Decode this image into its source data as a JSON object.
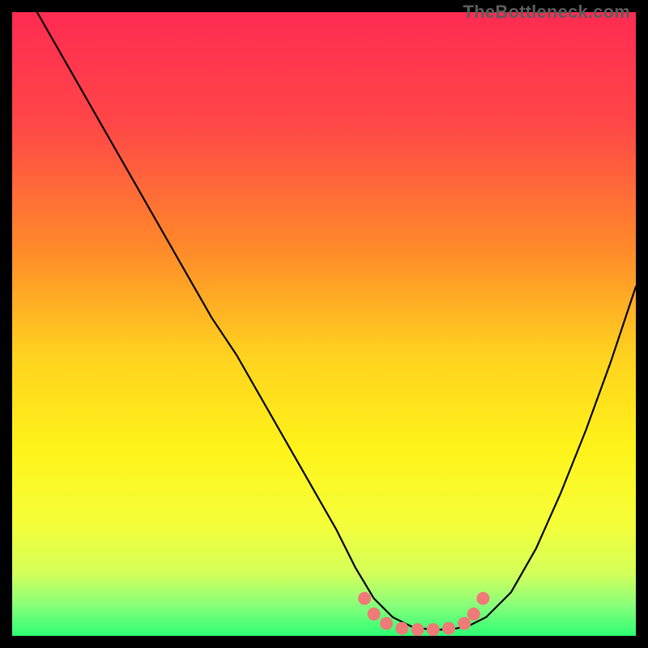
{
  "watermark": "TheBottleneck.com",
  "chart_data": {
    "type": "line",
    "title": "",
    "xlabel": "",
    "ylabel": "",
    "xlim": [
      0,
      100
    ],
    "ylim": [
      0,
      100
    ],
    "background_gradient": {
      "stops": [
        {
          "offset": 0.0,
          "color": "#ff2b52"
        },
        {
          "offset": 0.18,
          "color": "#ff4747"
        },
        {
          "offset": 0.38,
          "color": "#ff8a2a"
        },
        {
          "offset": 0.55,
          "color": "#ffd21f"
        },
        {
          "offset": 0.7,
          "color": "#fff31a"
        },
        {
          "offset": 0.82,
          "color": "#f5ff3a"
        },
        {
          "offset": 0.9,
          "color": "#d4ff5a"
        },
        {
          "offset": 0.95,
          "color": "#8aff7a"
        },
        {
          "offset": 1.0,
          "color": "#2dff74"
        }
      ]
    },
    "series": [
      {
        "name": "bottleneck-curve",
        "color": "#000000",
        "width": 2.2,
        "x": [
          4,
          8,
          12,
          16,
          20,
          24,
          28,
          32,
          36,
          40,
          44,
          48,
          52,
          55,
          58,
          61,
          64,
          67,
          70,
          73,
          76,
          80,
          84,
          88,
          92,
          96,
          100
        ],
        "y": [
          100,
          93,
          86,
          79,
          72,
          65,
          58,
          51,
          45,
          38,
          31,
          24,
          17,
          11,
          6,
          3,
          1.5,
          1,
          1,
          1.5,
          3,
          7,
          14,
          23,
          33,
          44,
          56
        ]
      }
    ],
    "marker_cluster": {
      "name": "highlight-dots",
      "color": "#ef7a78",
      "radius": 8,
      "points": [
        {
          "x": 56.5,
          "y": 6.0
        },
        {
          "x": 58.0,
          "y": 3.5
        },
        {
          "x": 60.0,
          "y": 2.0
        },
        {
          "x": 62.5,
          "y": 1.2
        },
        {
          "x": 65.0,
          "y": 1.0
        },
        {
          "x": 67.5,
          "y": 1.0
        },
        {
          "x": 70.0,
          "y": 1.2
        },
        {
          "x": 72.5,
          "y": 2.0
        },
        {
          "x": 74.0,
          "y": 3.5
        },
        {
          "x": 75.5,
          "y": 6.0
        }
      ]
    }
  }
}
